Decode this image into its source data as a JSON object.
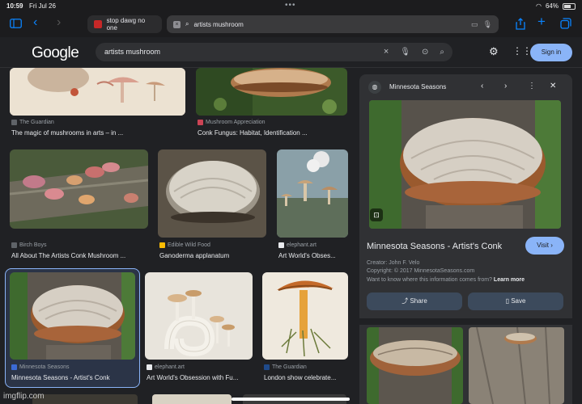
{
  "status_bar": {
    "time": "10:59",
    "date": "Fri Jul 26",
    "battery": "64%",
    "battery_level": 0.64
  },
  "safari": {
    "tabs": [
      {
        "label": "stop dawg no one",
        "active": false
      },
      {
        "label": "artists mushroom",
        "active": true
      }
    ]
  },
  "google": {
    "logo": "Google",
    "query": "artists mushroom",
    "sign_in": "Sign in"
  },
  "results": [
    {
      "source": "The Guardian",
      "title": "The magic of mushrooms in arts – in ..."
    },
    {
      "source": "Mushroom Appreciation",
      "title": "Conk Fungus: Habitat, Identification ..."
    },
    {
      "source": "Birch Boys",
      "title": "All About The Artists Conk Mushroom ..."
    },
    {
      "source": "Edible Wild Food",
      "title": "Ganoderma applanatum"
    },
    {
      "source": "elephant.art",
      "title": "Art World's Obses..."
    },
    {
      "source": "Minnesota Seasons",
      "title": "Minnesota Seasons - Artist's Conk"
    },
    {
      "source": "elephant.art",
      "title": "Art World's Obsession with Fu..."
    },
    {
      "source": "The Guardian",
      "title": "London show celebrate..."
    }
  ],
  "panel": {
    "site": "Minnesota Seasons",
    "title": "Minnesota Seasons - Artist's Conk",
    "visit": "Visit",
    "creator": "Creator: John F. Velo",
    "copyright": "Copyright: © 2017 MinnesotaSeasons.com",
    "info_question": "Want to know where this information comes from?",
    "learn_more": "Learn more",
    "share": "Share",
    "save": "Save"
  },
  "watermark": "imgflip.com",
  "colors": {
    "accent": "#8ab4f8",
    "background": "#202124",
    "panel": "#303134"
  }
}
